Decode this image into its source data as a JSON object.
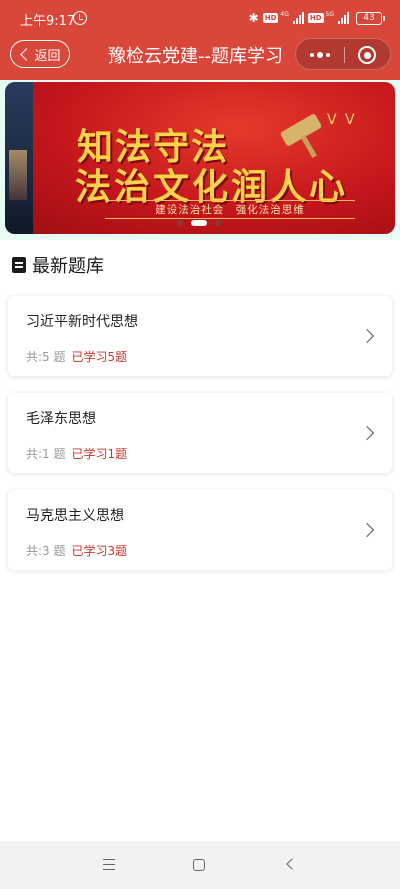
{
  "status_bar": {
    "time": "上午9:17",
    "net_label_1": "4G",
    "net_label_2": "5G",
    "hd_label": "HD",
    "battery": "43"
  },
  "header": {
    "back_label": "返回",
    "title": "豫检云党建--题库学习"
  },
  "banner": {
    "line1": "知法守法",
    "line2": "法治文化润人心",
    "subtitle": "建设法治社会　强化法治思维",
    "slides": 3,
    "active_slide": 2
  },
  "section": {
    "title": "最新题库"
  },
  "cards": [
    {
      "title": "习近平新时代思想",
      "count": "共:5 题",
      "learned": "已学习5题"
    },
    {
      "title": "毛泽东思想",
      "count": "共:1 题",
      "learned": "已学习1题"
    },
    {
      "title": "马克思主义思想",
      "count": "共:3 题",
      "learned": "已学习3题"
    }
  ],
  "colors": {
    "brand_red": "#d9463a",
    "learned_red": "#c8362d",
    "banner_mint": "#e6fcf4"
  }
}
